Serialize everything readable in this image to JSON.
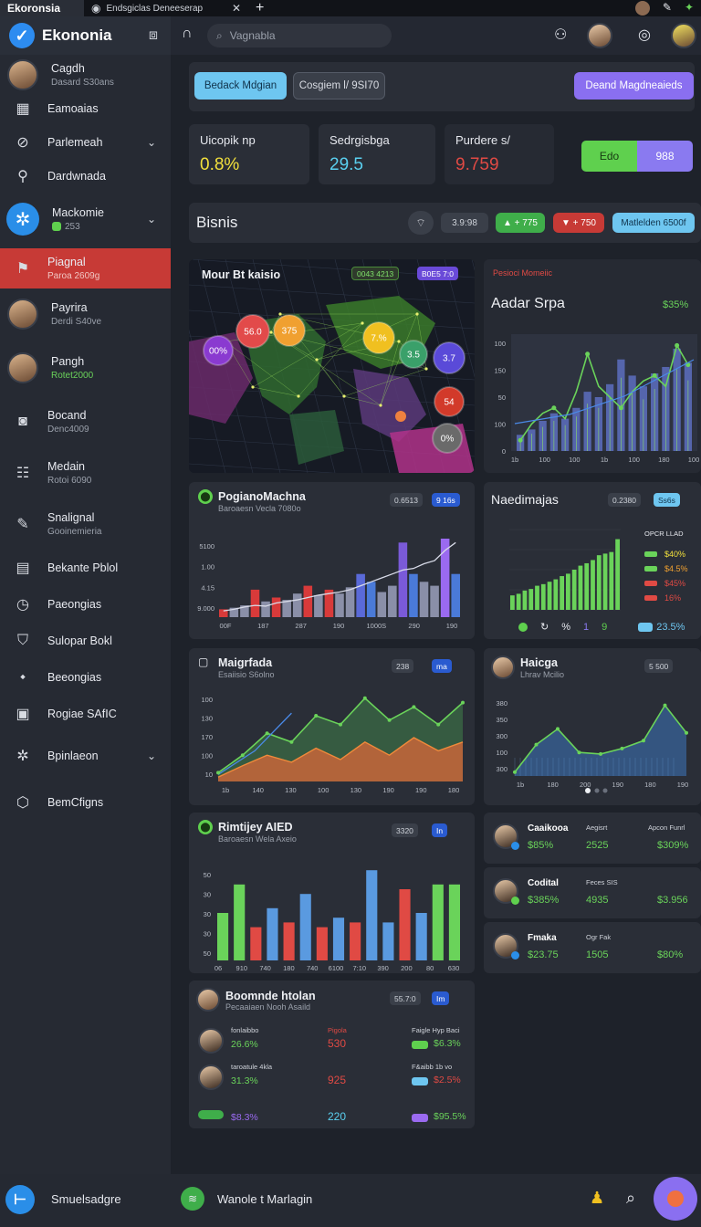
{
  "tabs": [
    {
      "label": "Ekoronsia"
    },
    {
      "label": "Endsgiclas Deneeserap"
    }
  ],
  "app": {
    "name": "Ekononia"
  },
  "search": {
    "placeholder": "Vagnabla"
  },
  "sidebar": {
    "items": [
      {
        "title": "Cagdh",
        "sub": "Dasard S30ans",
        "icon": "avatar"
      },
      {
        "title": "Eamoaias",
        "sub": "",
        "icon": "qr-icon"
      },
      {
        "title": "Parlemeah",
        "sub": "",
        "icon": "check-circle-icon",
        "chevron": true
      },
      {
        "title": "Dardwnada",
        "sub": "",
        "icon": "pin-icon"
      },
      {
        "title": "Mackomie",
        "sub": "253",
        "icon": "gear-icon",
        "chevron": true
      },
      {
        "title": "Piagnal",
        "sub": "Paroa 2609g",
        "icon": "bookmark-icon",
        "active": true
      },
      {
        "title": "Payrira",
        "sub": "Derdi S40ve",
        "icon": "avatar"
      },
      {
        "title": "Pangh",
        "sub": "Rotet2000",
        "icon": "avatar"
      },
      {
        "title": "Bocand",
        "sub": "Denc4009",
        "icon": "camera-icon"
      },
      {
        "title": "Medain",
        "sub": "Rotoi 6090",
        "icon": "table-icon"
      },
      {
        "title": "Snalignal",
        "sub": "Gooinemieria",
        "icon": "pen-icon"
      },
      {
        "title": "Bekante Pblol",
        "sub": "",
        "icon": "doc-icon"
      },
      {
        "title": "Paeongias",
        "sub": "",
        "icon": "clock-icon"
      },
      {
        "title": "Sulopar Bokl",
        "sub": "",
        "icon": "shield-icon"
      },
      {
        "title": "Beeongias",
        "sub": "",
        "icon": "tag-icon"
      },
      {
        "title": "Rogiae SAfIC",
        "sub": "",
        "icon": "lock-icon"
      },
      {
        "title": "Bpinlaeon",
        "sub": "",
        "icon": "settings-icon",
        "chevron": true
      },
      {
        "title": "BemCfigns",
        "sub": "",
        "icon": "cube-icon"
      }
    ]
  },
  "toolbar": {
    "btn1": "Bedack Mdgian",
    "btn2": "Cosgiem l/ 9SI70",
    "btn3": "Deand Magdneaieds"
  },
  "stats": [
    {
      "label": "Uicopik np",
      "value": "0.8%",
      "color": "#f2e03c"
    },
    {
      "label": "Sedrgisbga",
      "value": "29.5",
      "color": "#5ad0f0"
    },
    {
      "label": "Purdere s/",
      "value": "9.759",
      "color": "#e04a44"
    }
  ],
  "toggle": {
    "left": "Edo",
    "right": "988"
  },
  "section": {
    "title": "Bisnis",
    "pills": [
      "3.9:98",
      "▲ + 775",
      "▼ + 750",
      "Matlelden 6500f"
    ]
  },
  "map": {
    "title": "Mour Bt kaisio",
    "tag1": "0043 4213",
    "tag2": "B0E5 7:0",
    "bubbles": [
      {
        "label": "00%",
        "color": "#8a3ad0"
      },
      {
        "label": "56.0",
        "color": "#e24a4a"
      },
      {
        "label": "375",
        "color": "#f0a030"
      },
      {
        "label": "7.%",
        "color": "#f0c020"
      },
      {
        "label": "3.5",
        "color": "#3aa06a"
      },
      {
        "label": "3.7",
        "color": "#5a4ad8"
      },
      {
        "label": "54",
        "color": "#d23a2a"
      },
      {
        "label": "0%",
        "color": "#6a6a6a"
      }
    ]
  },
  "charts": {
    "c1": {
      "subtitle": "Pesioci Momeiic",
      "title": "Aadar Srpa",
      "badge": "$35%",
      "type": "bar",
      "ticks_y": [
        "100",
        "150",
        "50",
        "100",
        "0"
      ],
      "ticks_x": [
        "1b",
        "100",
        "100",
        "1b",
        "100",
        "180",
        "100"
      ]
    },
    "c2": {
      "title": "PogianoMachna",
      "subtitle": "Baroaesn Vecla 7080o",
      "tag1": "0.6513",
      "tag2": "9 16s",
      "type": "bar",
      "ticks_y": [
        "5100",
        "1.00",
        "4.15",
        "9.000"
      ],
      "ticks_x": [
        "00F",
        "187",
        "287",
        "190",
        "1000S",
        "290",
        "190"
      ]
    },
    "c3": {
      "title": "Naedimajas",
      "tag1": "0.2380",
      "tag2": "Ss6s",
      "legend_title": "OPCR LLAD",
      "legend": [
        {
          "value": "$40%",
          "color": "#f2e03c"
        },
        {
          "value": "$4.5%",
          "color": "#f0a030"
        },
        {
          "value": "$45%",
          "color": "#e04a44"
        },
        {
          "value": "16%",
          "color": "#e04a44"
        }
      ],
      "footer": [
        "%",
        "1",
        "9",
        "23.5%"
      ],
      "type": "bar"
    },
    "c4": {
      "title": "Maigrfada",
      "subtitle": "Esaiisio S6olno",
      "tag1": "238",
      "tag2": "ma",
      "type": "area",
      "ticks_y": [
        "100",
        "130",
        "170",
        "100",
        "10"
      ],
      "ticks_x": [
        "1b",
        "140",
        "130",
        "100",
        "130",
        "190",
        "190",
        "180"
      ]
    },
    "c5": {
      "title": "Haicga",
      "subtitle": "Lhrav Mcilio",
      "tag1": "5 500",
      "type": "area",
      "ticks_y": [
        "380",
        "350",
        "300",
        "100",
        "300"
      ],
      "ticks_x": [
        "1b",
        "180",
        "200",
        "190",
        "180",
        "190"
      ]
    },
    "c6": {
      "title": "Rimtijey AIED",
      "subtitle": "Baroaesn Wela Axeio",
      "tag1": "3320",
      "tag2": "In",
      "type": "bar",
      "ticks_y": [
        "50",
        "30",
        "30",
        "30",
        "50"
      ],
      "ticks_x": [
        "06",
        "910",
        "740",
        "180",
        "740",
        "6100",
        "7:10",
        "390",
        "200",
        "80",
        "630"
      ]
    },
    "c7": {
      "title": "Boomnde htolan",
      "subtitle": "Pecaaiaen Nooh Asaild",
      "tag1": "55.7:0",
      "tag2": "Im",
      "rows": [
        {
          "label": "fonlaibbo",
          "v1": "26.6%",
          "mid_label": "Pigola",
          "mid": "530",
          "right_label": "Faigle Hyp Baci",
          "right": "$6.3%",
          "mid_color": "#e04a44"
        },
        {
          "label": "taroatule 4kla",
          "v1": "31.3%",
          "mid_label": "",
          "mid": "925",
          "right_label": "F&aibb 1b vo",
          "right": "$2.5%",
          "mid_color": "#e04a44"
        },
        {
          "label": "",
          "v1": "$8.3%",
          "mid_label": "",
          "mid": "220",
          "right_label": "",
          "right": "$95.5%",
          "mid_color": "#5ad0f0"
        }
      ]
    }
  },
  "people": [
    {
      "name": "Caaikooa",
      "c1h": "Aegisrt",
      "c2h": "Apcon Funrl",
      "v1": "$85%",
      "v2": "2525",
      "v3": "$309%"
    },
    {
      "name": "Codital",
      "c1h": "Feces SIS",
      "c2h": "",
      "v1": "$385%",
      "v2": "4935",
      "v3": "$3.956"
    },
    {
      "name": "Fmaka",
      "c1h": "Ogr Fak",
      "c2h": "",
      "v1": "$23.75",
      "v2": "1505",
      "v3": "$80%"
    }
  ],
  "bottom": {
    "left": "Smuelsadgre",
    "mid": "Wanole t Marlagin"
  }
}
